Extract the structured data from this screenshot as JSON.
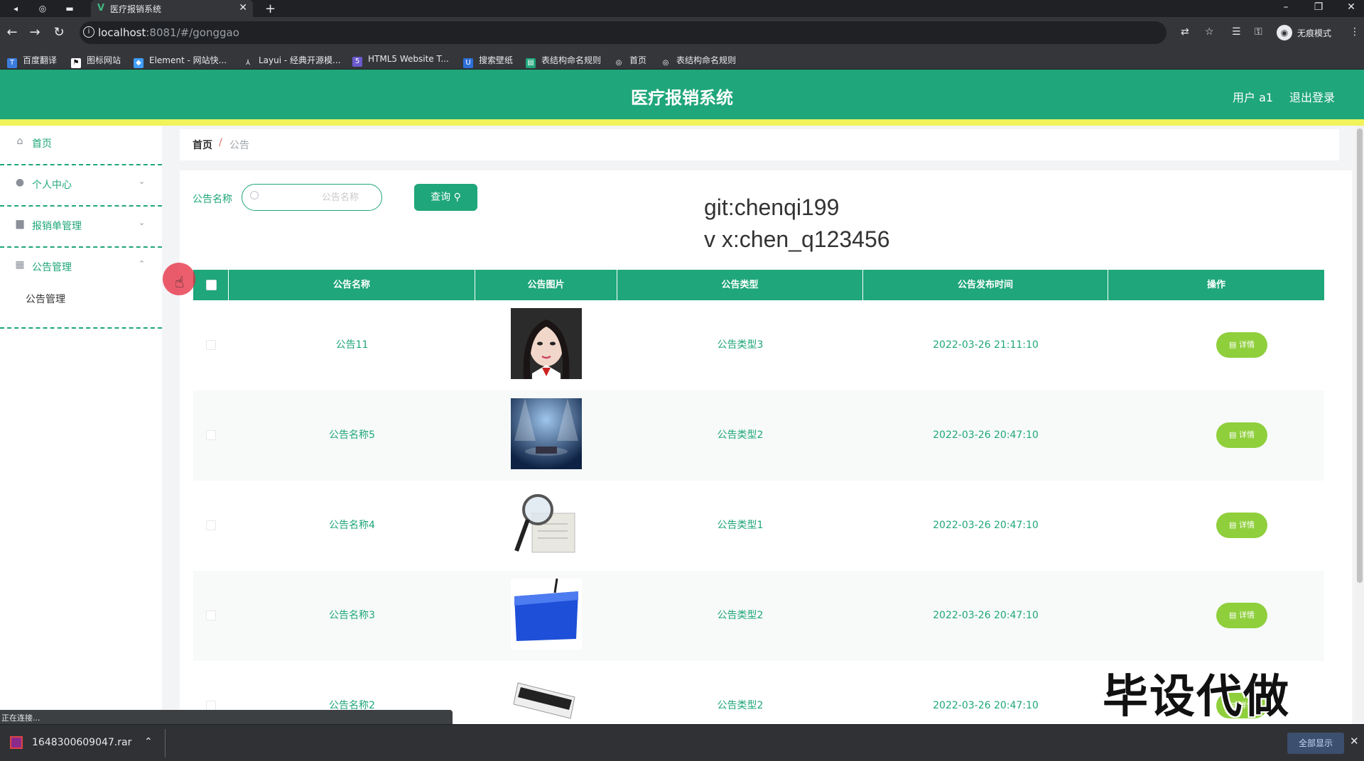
{
  "browser": {
    "tab_title": "医疗报销系统",
    "url_host": "localhost",
    "url_rest": ":8081/#/gonggao",
    "profile_label": "无痕模式",
    "bookmarks": [
      "百度翻译",
      "图标网站",
      "Element - 网站快...",
      "Layui - 经典开源模...",
      "HTML5 Website T...",
      "搜索壁纸",
      "表结构命名规则",
      "首页",
      "表结构命名规则"
    ]
  },
  "header": {
    "title": "医疗报销系统",
    "user": "用户 a1",
    "logout": "退出登录"
  },
  "sidebar": {
    "items": [
      {
        "label": "首页",
        "icon": "home-icon"
      },
      {
        "label": "个人中心",
        "icon": "user-icon"
      },
      {
        "label": "报销单管理",
        "icon": "briefcase-icon"
      },
      {
        "label": "公告管理",
        "icon": "grid-icon"
      }
    ],
    "submenu": "公告管理"
  },
  "breadcrumb": {
    "home": "首页",
    "separator": "/",
    "current": "公告"
  },
  "search": {
    "label": "公告名称",
    "placeholder": "公告名称",
    "button": "查询"
  },
  "watermark": {
    "line1": "git:chenqi199",
    "line2": "v x:chen_q123456"
  },
  "table": {
    "headers": [
      "公告名称",
      "公告图片",
      "公告类型",
      "公告发布时间",
      "操作"
    ],
    "rows": [
      {
        "name": "公告11",
        "type": "公告类型3",
        "time": "2022-03-26 21:11:10",
        "action": "详情",
        "image": "portrait"
      },
      {
        "name": "公告名称5",
        "type": "公告类型2",
        "time": "2022-03-26 20:47:10",
        "action": "详情",
        "image": "news-stage"
      },
      {
        "name": "公告名称4",
        "type": "公告类型1",
        "time": "2022-03-26 20:47:10",
        "action": "详情",
        "image": "magnifier"
      },
      {
        "name": "公告名称3",
        "type": "公告类型2",
        "time": "2022-03-26 20:47:10",
        "action": "详情",
        "image": "news-sign"
      },
      {
        "name": "公告名称2",
        "type": "公告类型2",
        "time": "2022-03-26 20:47:10",
        "action": "详情",
        "image": "news-paper"
      }
    ]
  },
  "overlay_text": "毕设代做",
  "status_text": "正在连接...",
  "download": {
    "filename": "1648300609047.rar",
    "show_all": "全部显示"
  },
  "colors": {
    "primary": "#1fa67a",
    "accent_bar": "#f0f35a",
    "detail_button": "#8fcf3c"
  }
}
